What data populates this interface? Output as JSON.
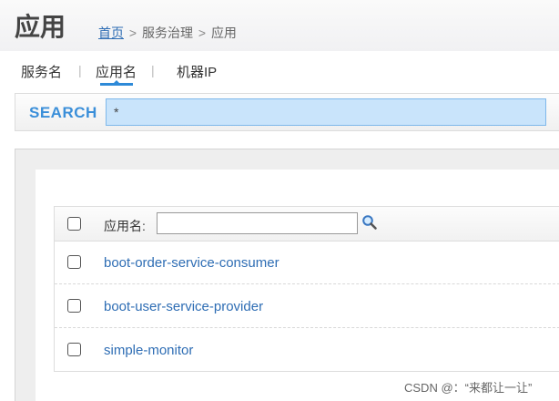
{
  "header": {
    "title": "应用",
    "breadcrumb": {
      "home": "首页",
      "separator": ">",
      "section": "服务治理",
      "current": "应用"
    }
  },
  "tabs": [
    {
      "label": "服务名",
      "active": false
    },
    {
      "label": "应用名",
      "active": true
    },
    {
      "label": "机器IP",
      "active": false
    }
  ],
  "tab_divider": "|",
  "search": {
    "label": "SEARCH",
    "value": "*",
    "accent_color": "#3b8fd9"
  },
  "table": {
    "filter_label": "应用名:",
    "filter_value": "",
    "rows": [
      {
        "name": "boot-order-service-consumer",
        "checked": false
      },
      {
        "name": "boot-user-service-provider",
        "checked": false
      },
      {
        "name": "simple-monitor",
        "checked": false
      }
    ],
    "link_color": "#2e6db4"
  },
  "watermark": "CSDN @：“来都让一让”"
}
